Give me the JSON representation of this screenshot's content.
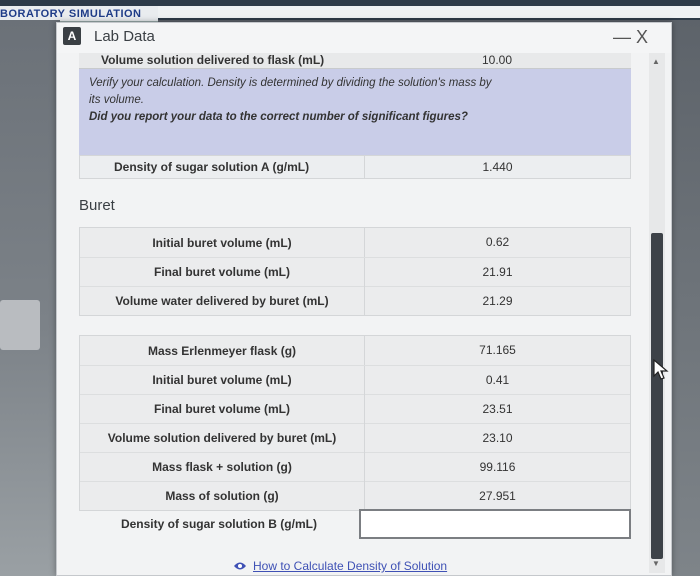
{
  "app": {
    "title": "BORATORY SIMULATION"
  },
  "panel": {
    "badge": "A",
    "title": "Lab Data",
    "minimize_label": "—",
    "close_label": "X"
  },
  "solution_a": {
    "volume_row": {
      "label": "Volume solution delivered to flask (mL)",
      "value": "10.00"
    },
    "feedback": {
      "line1": "Verify your calculation. Density is determined by dividing the solution's mass by",
      "line2": "its volume.",
      "line3": "Did you report your data to the correct number of significant figures?"
    },
    "density_row": {
      "label": "Density of sugar solution A (g/mL)",
      "value": "1.440"
    }
  },
  "buret": {
    "heading": "Buret",
    "rows": [
      {
        "label": "Initial buret volume (mL)",
        "value": "0.62"
      },
      {
        "label": "Final buret volume (mL)",
        "value": "21.91"
      },
      {
        "label": "Volume water delivered by buret (mL)",
        "value": "21.29"
      }
    ]
  },
  "solution_b": {
    "rows": [
      {
        "label": "Mass Erlenmeyer flask (g)",
        "value": "71.165"
      },
      {
        "label": "Initial buret volume (mL)",
        "value": "0.41"
      },
      {
        "label": "Final buret volume (mL)",
        "value": "23.51"
      },
      {
        "label": "Volume solution delivered by buret (mL)",
        "value": "23.10"
      },
      {
        "label": "Mass flask + solution (g)",
        "value": "99.116"
      },
      {
        "label": "Mass of solution (g)",
        "value": "27.951"
      }
    ],
    "density_row": {
      "label": "Density of sugar solution B (g/mL)",
      "value": ""
    }
  },
  "help": {
    "link_text": "How to Calculate Density of Solution",
    "icon": "eye-icon"
  },
  "colors": {
    "feedback_bg": "#c9cde8",
    "link": "#3f51b5",
    "title_blue": "#1f3c88"
  }
}
